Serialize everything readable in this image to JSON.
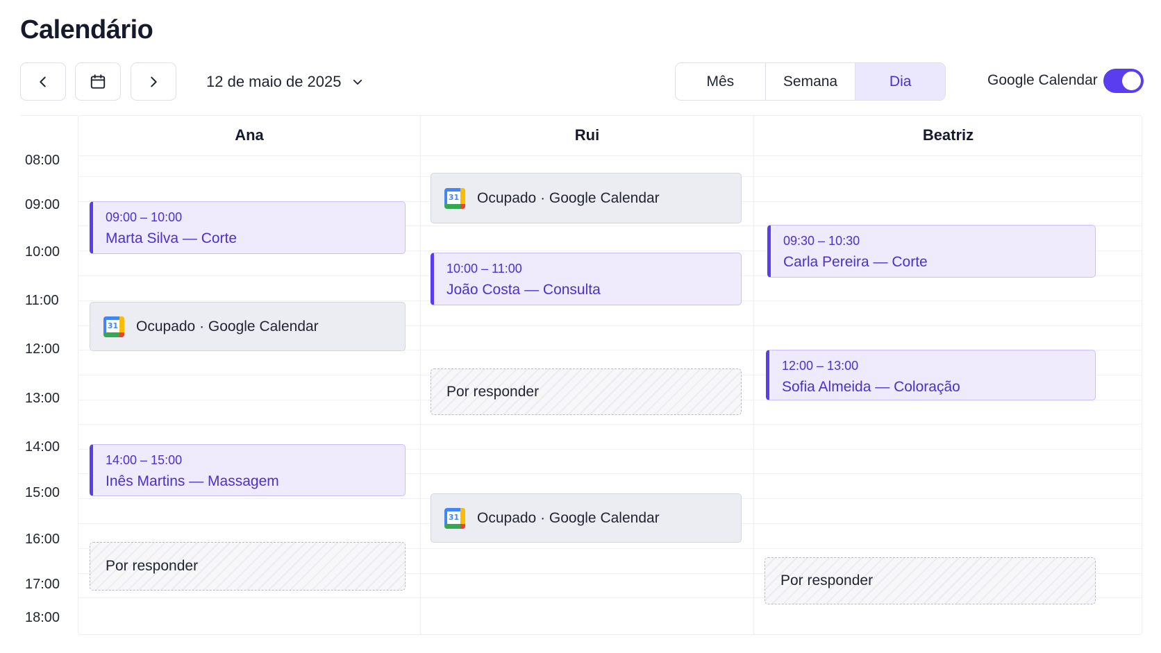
{
  "page": {
    "title": "Calendário"
  },
  "toolbar": {
    "prev_icon": "chevron-left-icon",
    "today_icon": "calendar-icon",
    "next_icon": "chevron-right-icon",
    "date": "12 de maio de 2025",
    "date_dropdown_icon": "chevron-down-icon",
    "views": [
      {
        "label": "Mês",
        "active": false
      },
      {
        "label": "Semana",
        "active": false
      },
      {
        "label": "Dia",
        "active": true
      }
    ],
    "google_calendar_label": "Google Calendar",
    "google_calendar_enabled": true
  },
  "staff": [
    {
      "name": "Ana"
    },
    {
      "name": "Rui"
    },
    {
      "name": "Beatriz"
    }
  ],
  "hours": [
    "08:00",
    "09:00",
    "10:00",
    "11:00",
    "12:00",
    "13:00",
    "14:00",
    "15:00",
    "16:00",
    "17:00",
    "18:00"
  ],
  "events": {
    "ana": [
      {
        "type": "appointment",
        "time": "09:00 – 10:00",
        "title": "Marta Silva — Corte"
      },
      {
        "type": "busy",
        "label": "Ocupado · Google Calendar",
        "icon": "google-calendar-icon",
        "icon_text": "31"
      },
      {
        "type": "appointment",
        "time": "14:00 – 15:00",
        "title": "Inês Martins — Massagem"
      },
      {
        "type": "pending",
        "label": "Por responder"
      }
    ],
    "rui": [
      {
        "type": "busy",
        "label": "Ocupado · Google Calendar",
        "icon": "google-calendar-icon",
        "icon_text": "31"
      },
      {
        "type": "appointment",
        "time": "10:00 – 11:00",
        "title": "João Costa — Consulta"
      },
      {
        "type": "pending",
        "label": "Por responder"
      },
      {
        "type": "busy",
        "label": "Ocupado · Google Calendar",
        "icon": "google-calendar-icon",
        "icon_text": "31"
      }
    ],
    "beatriz": [
      {
        "type": "appointment",
        "time": "09:30 – 10:30",
        "title": "Carla Pereira — Corte"
      },
      {
        "type": "appointment",
        "time": "12:00 – 13:00",
        "title": "Sofia Almeida — Coloração"
      },
      {
        "type": "pending",
        "label": "Por responder"
      }
    ]
  },
  "colors": {
    "accent": "#5b3df0",
    "appointment_bg": "#efebfd",
    "busy_bg": "#ecedf3",
    "active_view_bg": "#ebe7fd"
  }
}
